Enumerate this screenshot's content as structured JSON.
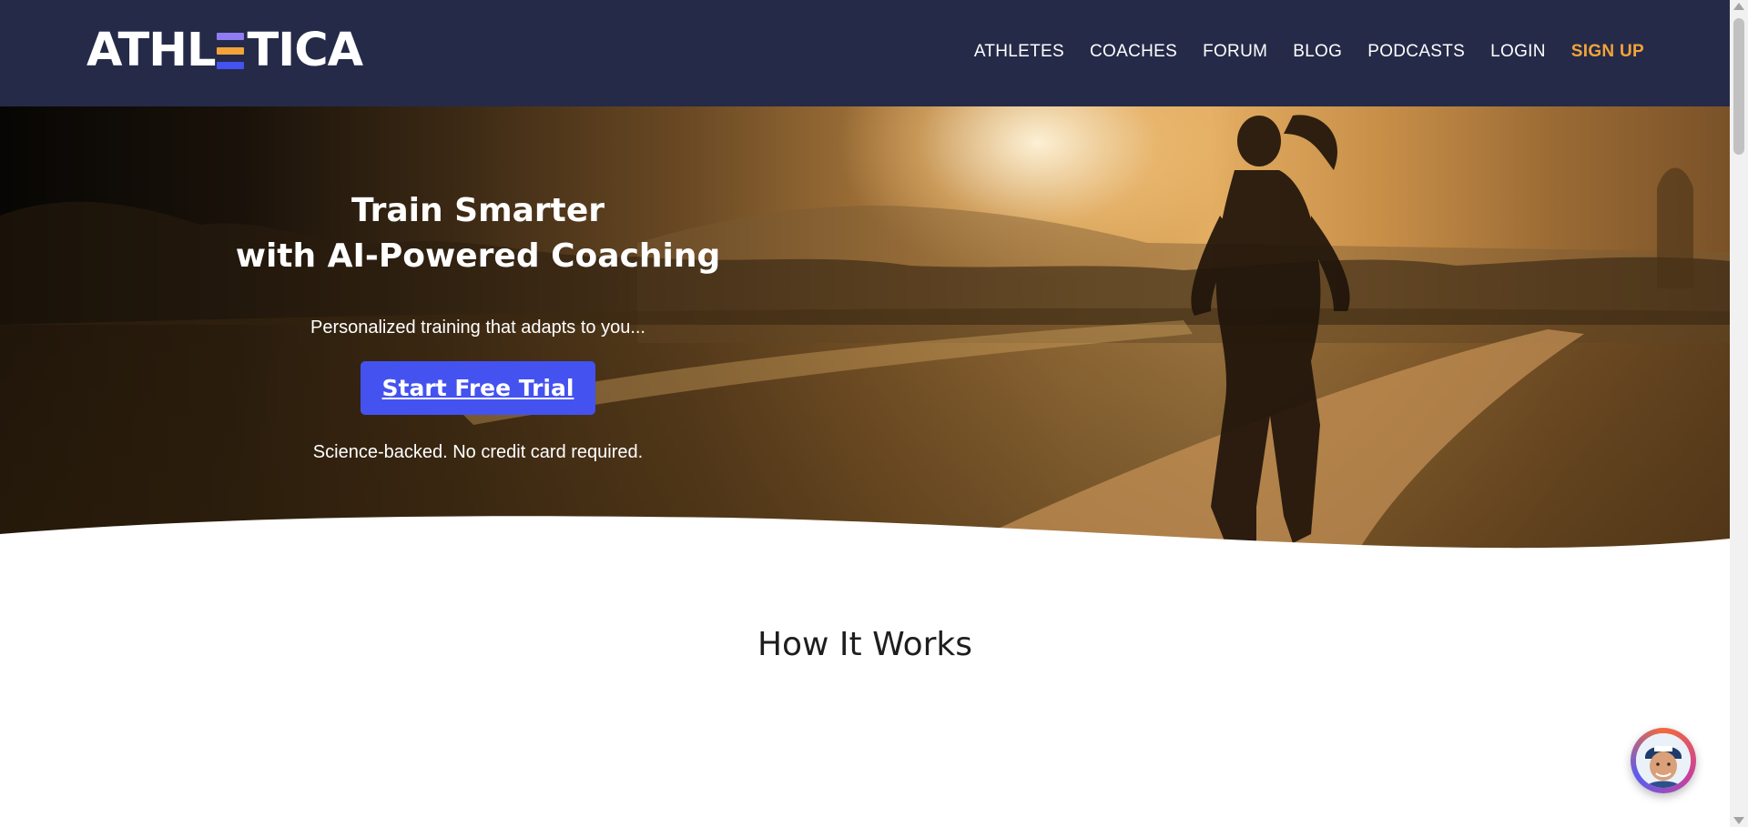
{
  "brand": {
    "logo_left": "ATHL",
    "logo_right": "TICA",
    "logo_bar_colors": [
      "#8f7cf3",
      "#f2a33a",
      "#4452f0"
    ]
  },
  "nav": {
    "items": [
      {
        "label": "ATHLETES"
      },
      {
        "label": "COACHES"
      },
      {
        "label": "FORUM"
      },
      {
        "label": "BLOG"
      },
      {
        "label": "PODCASTS"
      },
      {
        "label": "LOGIN"
      },
      {
        "label": "SIGN UP"
      }
    ]
  },
  "hero": {
    "title_line1": "Train Smarter",
    "title_line2": "with AI-Powered Coaching",
    "subtitle": "Personalized training that adapts to you...",
    "cta_label": "Start Free Trial",
    "note": "Science-backed. No credit card required."
  },
  "section": {
    "how_title": "How It Works"
  },
  "colors": {
    "nav_bg": "#252a48",
    "accent": "#4452f0",
    "signup": "#f2a33a"
  },
  "icons": {
    "chat": "coach-avatar-icon"
  }
}
